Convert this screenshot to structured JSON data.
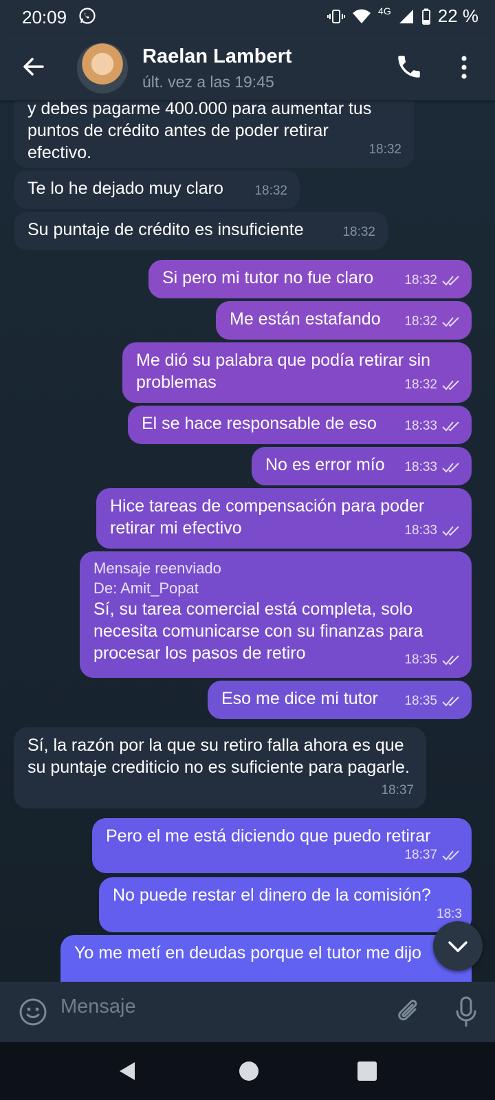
{
  "status_bar": {
    "time": "20:09",
    "network": "4G",
    "battery": "22 %"
  },
  "header": {
    "contact_name": "Raelan Lambert",
    "last_seen": "últ. vez a las 19:45"
  },
  "messages": [
    {
      "dir": "in",
      "text": "y debes pagarme 400.000 para aumentar tus puntos de crédito antes de poder retirar efectivo.",
      "time": "18:32"
    },
    {
      "dir": "in",
      "text": "Te lo he dejado muy claro",
      "time": "18:32"
    },
    {
      "dir": "in",
      "text": "Su puntaje de crédito es insuficiente",
      "time": "18:32"
    },
    {
      "dir": "out",
      "text": "Si pero mi tutor no fue claro",
      "time": "18:32"
    },
    {
      "dir": "out",
      "text": "Me están estafando",
      "time": "18:32"
    },
    {
      "dir": "out",
      "text": "Me dió su palabra que podía retirar sin problemas",
      "time": "18:32"
    },
    {
      "dir": "out",
      "text": "El se hace responsable de eso",
      "time": "18:33"
    },
    {
      "dir": "out",
      "text": "No es error mío",
      "time": "18:33"
    },
    {
      "dir": "out",
      "text": "Hice tareas de compensación para poder retirar mi efectivo",
      "time": "18:33"
    },
    {
      "dir": "out",
      "forwarded_label": "Mensaje reenviado",
      "forwarded_from": "De: Amit_Popat",
      "text": "Sí, su tarea comercial está completa, solo necesita comunicarse con su finanzas para procesar los pasos de retiro",
      "time": "18:35"
    },
    {
      "dir": "out",
      "text": "Eso me dice mi tutor",
      "time": "18:35"
    },
    {
      "dir": "in",
      "text": "Sí, la razón por la que su retiro falla ahora es que su puntaje crediticio no es suficiente para pagarle.",
      "time": "18:37"
    },
    {
      "dir": "out",
      "text": "Pero el me está diciendo que puedo retirar",
      "time": "18:37"
    },
    {
      "dir": "out",
      "text": "No puede restar el dinero de la comisión?",
      "time": "18:3"
    },
    {
      "dir": "out",
      "text": "Yo me metí en deudas porque el tutor me dijo",
      "time": ""
    }
  ],
  "composer": {
    "placeholder": "Mensaje"
  },
  "colors": {
    "header_bg": "#232e3c",
    "incoming_bubble": "#232f3e",
    "outgoing_bubble_top": "#9b4fc2",
    "outgoing_bubble_bottom": "#6a5ff0"
  },
  "icons": [
    "whatsapp-icon",
    "vibrate-icon",
    "wifi-icon",
    "signal-icon",
    "battery-icon",
    "back-arrow-icon",
    "phone-icon",
    "more-vert-icon",
    "emoji-icon",
    "paperclip-icon",
    "microphone-icon",
    "chevron-down-icon",
    "double-check-icon"
  ]
}
